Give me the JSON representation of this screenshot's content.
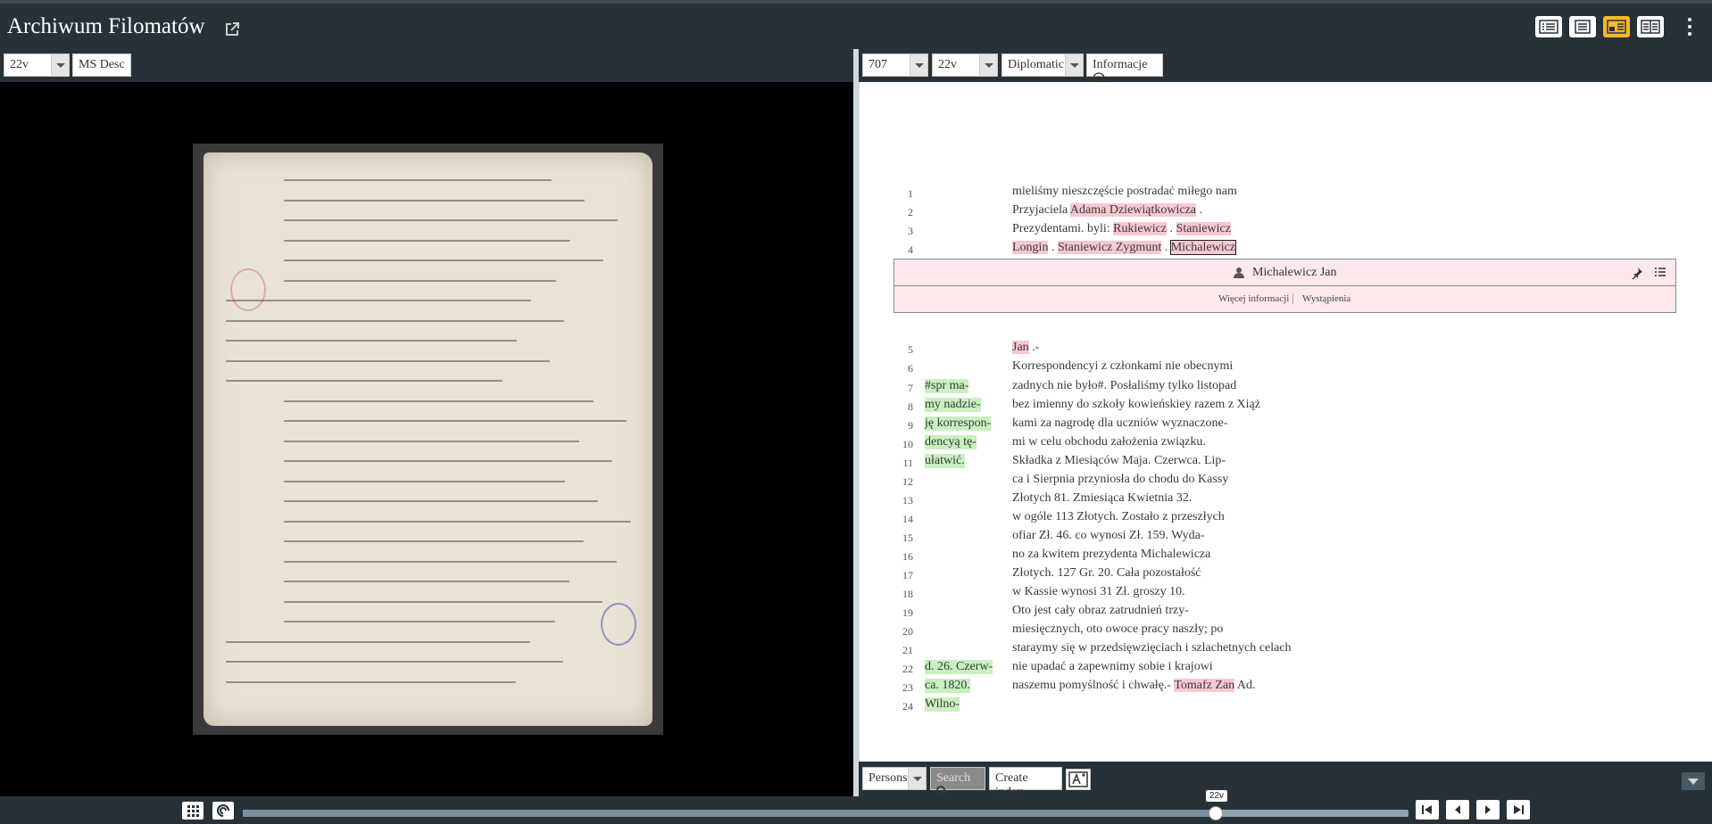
{
  "app": {
    "title": "Archiwum Filomatów"
  },
  "left": {
    "folio_select": "22v",
    "ms_desc_label": "MS Desc"
  },
  "right": {
    "doc_select": "707",
    "folio_select": "22v",
    "edition_select": "Diplomatic",
    "info_label": "Informacje"
  },
  "lines": [
    {
      "n": "1",
      "margin": "",
      "text": "mieliśmy nieszczęście postradać miłego nam"
    },
    {
      "n": "2",
      "margin": "",
      "pre": "Przyjaciela ",
      "person": "Adama Dziewiątkowicza",
      "post": " ."
    },
    {
      "n": "3",
      "margin": "",
      "pre": "Prezydentami. byli: ",
      "person": "Rukiewicz",
      "mid": " . ",
      "person2": "Staniewicz",
      "post": ""
    },
    {
      "n": "4",
      "margin": "",
      "person": "Longin",
      "mid": " . ",
      "person2": "Staniewicz Zygmunt",
      "mid2": " . ",
      "person3": "Michalewicz"
    },
    {
      "n": "5",
      "margin": "",
      "person": "Jan",
      "post": " .-"
    },
    {
      "n": "6",
      "margin": "",
      "text": "Korrespondencyi z członkami nie obecnymi"
    },
    {
      "n": "7",
      "margin": "#spr ma-",
      "text": "zadnych nie było#. Posłaliśmy tylko listopad"
    },
    {
      "n": "8",
      "margin": "my nadzie-",
      "text": " bez imienny do szkoły kowieńskiey razem z Xiąż"
    },
    {
      "n": "9",
      "margin": "ję korrespon-",
      "text": " kami za nagrodę dla uczniów wyznaczone-"
    },
    {
      "n": "10",
      "margin": "dencyą tę-",
      "text": "mi w celu obchodu założenia związku."
    },
    {
      "n": "11",
      "margin": "ułatwić.",
      "text": "  Składka z Miesiąców Maja. Czerwca. Lip-"
    },
    {
      "n": "12",
      "margin": "",
      "text": "ca i Sierpnia przyniosła do chodu do Kassy"
    },
    {
      "n": "13",
      "margin": "",
      "text": "Złotych 81. Zmiesiąca Kwietnia 32."
    },
    {
      "n": "14",
      "margin": "",
      "text": "w ogóle 113 Złotych. Zostało z przeszłych"
    },
    {
      "n": "15",
      "margin": "",
      "text": "ofiar Zł. 46. co wynosi Zł. 159. Wyda-"
    },
    {
      "n": "16",
      "margin": "",
      "text": "no za kwitem prezydenta Michalewicza"
    },
    {
      "n": "17",
      "margin": "",
      "text": "Złotych. 127 Gr. 20. Cała pozostałość"
    },
    {
      "n": "18",
      "margin": "",
      "text": "w Kassie wynosi 31 Zł. groszy 10."
    },
    {
      "n": "19",
      "margin": "",
      "text": "Oto jest cały obraz zatrudnień trzy-"
    },
    {
      "n": "20",
      "margin": "",
      "text": "miesięcznych, oto owoce pracy naszły; po"
    },
    {
      "n": "21",
      "margin": "",
      "text": "staraymy się w przedsięwzięciach i szlachetnych celach"
    },
    {
      "n": "22",
      "margin": "d. 26. Czerw-",
      "text": " nie upadać a zapewnimy sobie i krajowi"
    },
    {
      "n": "23",
      "margin": "ca. 1820.",
      "pre": "  naszemu pomyślność i chwałę.- ",
      "person": "Tomafz Zan",
      "post": " Ad."
    },
    {
      "n": "24",
      "margin": "Wilno-",
      "text": ""
    }
  ],
  "popup": {
    "name": "Michalewicz Jan",
    "more_info": "Więcej informacji",
    "occurrences": "Wystąpienia"
  },
  "bottom_right": {
    "list_select": "Persons",
    "search_label": "Search",
    "create_index_label": "Create index"
  },
  "slider": {
    "label": "22v",
    "position": 0.8345
  },
  "colors": {
    "person_highlight": "#f8c8d0",
    "note_highlight": "#c8f0c0",
    "header_bg": "#263238",
    "active_view": "#f6b82a"
  }
}
